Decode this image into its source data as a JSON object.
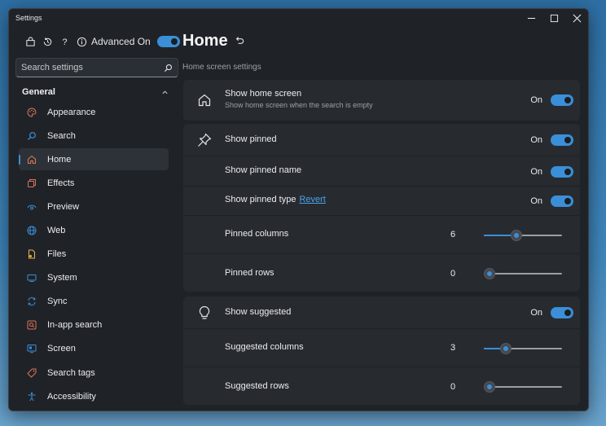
{
  "window": {
    "title": "Settings"
  },
  "toolbar": {
    "advanced_label": "Advanced On",
    "advanced_on": true
  },
  "search": {
    "placeholder": "Search settings"
  },
  "sidebar": {
    "group": "General",
    "items": [
      {
        "label": "Appearance",
        "icon": "appearance-icon",
        "color": "#e0715a"
      },
      {
        "label": "Search",
        "icon": "search-icon",
        "color": "#3a8fd8"
      },
      {
        "label": "Home",
        "icon": "home-icon",
        "color": "#e07a5a",
        "active": true
      },
      {
        "label": "Effects",
        "icon": "effects-icon",
        "color": "#e0715a"
      },
      {
        "label": "Preview",
        "icon": "preview-icon",
        "color": "#3a8fd8"
      },
      {
        "label": "Web",
        "icon": "globe-icon",
        "color": "#3a8fd8"
      },
      {
        "label": "Files",
        "icon": "files-icon",
        "color": "#e8b44a"
      },
      {
        "label": "System",
        "icon": "system-icon",
        "color": "#3a8fd8"
      },
      {
        "label": "Sync",
        "icon": "sync-icon",
        "color": "#3a8fd8"
      },
      {
        "label": "In-app search",
        "icon": "in-app-search-icon",
        "color": "#e0715a"
      },
      {
        "label": "Screen",
        "icon": "screen-icon",
        "color": "#3a8fd8"
      },
      {
        "label": "Search tags",
        "icon": "tag-icon",
        "color": "#e0715a"
      },
      {
        "label": "Accessibility",
        "icon": "accessibility-icon",
        "color": "#3a8fd8"
      }
    ]
  },
  "page": {
    "title": "Home",
    "subtitle": "Home screen settings"
  },
  "home_card": {
    "label": "Show home screen",
    "desc": "Show home screen when the search is empty",
    "state": "On"
  },
  "pinned_card": {
    "show_pinned": {
      "label": "Show pinned",
      "state": "On"
    },
    "show_pinned_name": {
      "label": "Show pinned name",
      "state": "On"
    },
    "show_pinned_type": {
      "label": "Show pinned type",
      "revert": "Revert",
      "state": "On"
    },
    "columns": {
      "label": "Pinned columns",
      "value": "6",
      "level": 0.4
    },
    "rows": {
      "label": "Pinned rows",
      "value": "0",
      "level": 0.0
    }
  },
  "suggested_card": {
    "show_suggested": {
      "label": "Show suggested",
      "state": "On"
    },
    "columns": {
      "label": "Suggested columns",
      "value": "3",
      "level": 0.24
    },
    "rows": {
      "label": "Suggested rows",
      "value": "0",
      "level": 0.0
    }
  },
  "colors": {
    "accent": "#3a8fd8",
    "window_bg": "#1f2328",
    "card_bg": "#272b30"
  }
}
